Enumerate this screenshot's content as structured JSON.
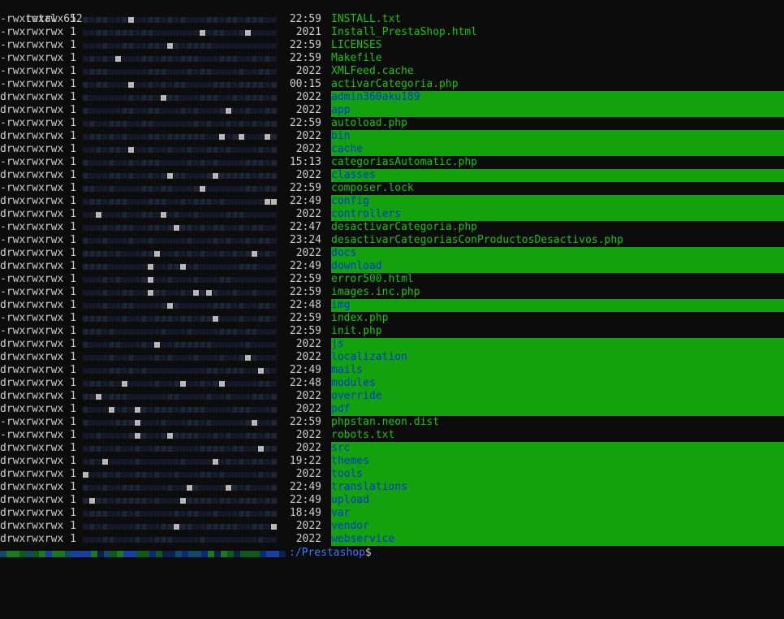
{
  "terminal": {
    "header": "total 652",
    "entries": [
      {
        "perm": "-rwxrwxrwx 1",
        "time": "22:59",
        "name": "INSTALL.txt",
        "dir": false
      },
      {
        "perm": "-rwxrwxrwx 1",
        "time": "2021",
        "name": "Install_PrestaShop.html",
        "dir": false
      },
      {
        "perm": "-rwxrwxrwx 1",
        "time": "22:59",
        "name": "LICENSES",
        "dir": false
      },
      {
        "perm": "-rwxrwxrwx 1",
        "time": "22:59",
        "name": "Makefile",
        "dir": false
      },
      {
        "perm": "-rwxrwxrwx 1",
        "time": "2022",
        "name": "XMLFeed.cache",
        "dir": false
      },
      {
        "perm": "-rwxrwxrwx 1",
        "time": "00:15",
        "name": "activarCategoria.php",
        "dir": false
      },
      {
        "perm": "drwxrwxrwx 1",
        "time": "2022",
        "name": "admin360aku189",
        "dir": true
      },
      {
        "perm": "drwxrwxrwx 1",
        "time": "2022",
        "name": "app",
        "dir": true
      },
      {
        "perm": "-rwxrwxrwx 1",
        "time": "22:59",
        "name": "autoload.php",
        "dir": false
      },
      {
        "perm": "drwxrwxrwx 1",
        "time": "2022",
        "name": "bin",
        "dir": true
      },
      {
        "perm": "drwxrwxrwx 1",
        "time": "2022",
        "name": "cache",
        "dir": true
      },
      {
        "perm": "-rwxrwxrwx 1",
        "time": "15:13",
        "name": "categoriasAutomatic.php",
        "dir": false
      },
      {
        "perm": "drwxrwxrwx 1",
        "time": "2022",
        "name": "classes",
        "dir": true
      },
      {
        "perm": "-rwxrwxrwx 1",
        "time": "22:59",
        "name": "composer.lock",
        "dir": false
      },
      {
        "perm": "drwxrwxrwx 1",
        "time": "22:49",
        "name": "config",
        "dir": true
      },
      {
        "perm": "drwxrwxrwx 1",
        "time": "2022",
        "name": "controllers",
        "dir": true
      },
      {
        "perm": "-rwxrwxrwx 1",
        "time": "22:47",
        "name": "desactivarCategoria.php",
        "dir": false
      },
      {
        "perm": "-rwxrwxrwx 1",
        "time": "23:24",
        "name": "desactivarCategoriasConProductosDesactivos.php",
        "dir": false
      },
      {
        "perm": "drwxrwxrwx 1",
        "time": "2022",
        "name": "docs",
        "dir": true
      },
      {
        "perm": "drwxrwxrwx 1",
        "time": "22:49",
        "name": "download",
        "dir": true
      },
      {
        "perm": "-rwxrwxrwx 1",
        "time": "22:59",
        "name": "error500.html",
        "dir": false
      },
      {
        "perm": "-rwxrwxrwx 1",
        "time": "22:59",
        "name": "images.inc.php",
        "dir": false
      },
      {
        "perm": "drwxrwxrwx 1",
        "time": "22:48",
        "name": "img",
        "dir": true
      },
      {
        "perm": "-rwxrwxrwx 1",
        "time": "22:59",
        "name": "index.php",
        "dir": false
      },
      {
        "perm": "-rwxrwxrwx 1",
        "time": "22:59",
        "name": "init.php",
        "dir": false
      },
      {
        "perm": "drwxrwxrwx 1",
        "time": "2022",
        "name": "js",
        "dir": true
      },
      {
        "perm": "drwxrwxrwx 1",
        "time": "2022",
        "name": "localization",
        "dir": true
      },
      {
        "perm": "drwxrwxrwx 1",
        "time": "22:49",
        "name": "mails",
        "dir": true
      },
      {
        "perm": "drwxrwxrwx 1",
        "time": "22:48",
        "name": "modules",
        "dir": true
      },
      {
        "perm": "drwxrwxrwx 1",
        "time": "2022",
        "name": "override",
        "dir": true
      },
      {
        "perm": "drwxrwxrwx 1",
        "time": "2022",
        "name": "pdf",
        "dir": true
      },
      {
        "perm": "-rwxrwxrwx 1",
        "time": "22:59",
        "name": "phpstan.neon.dist",
        "dir": false
      },
      {
        "perm": "-rwxrwxrwx 1",
        "time": "2022",
        "name": "robots.txt",
        "dir": false
      },
      {
        "perm": "drwxrwxrwx 1",
        "time": "2022",
        "name": "src",
        "dir": true
      },
      {
        "perm": "drwxrwxrwx 1",
        "time": "19:22",
        "name": "themes",
        "dir": true
      },
      {
        "perm": "drwxrwxrwx 1",
        "time": "2022",
        "name": "tools",
        "dir": true
      },
      {
        "perm": "drwxrwxrwx 1",
        "time": "22:49",
        "name": "translations",
        "dir": true
      },
      {
        "perm": "drwxrwxrwx 1",
        "time": "22:49",
        "name": "upload",
        "dir": true
      },
      {
        "perm": "drwxrwxrwx 1",
        "time": "18:49",
        "name": "var",
        "dir": true
      },
      {
        "perm": "drwxrwxrwx 1",
        "time": "2022",
        "name": "vendor",
        "dir": true
      },
      {
        "perm": "drwxrwxrwx 1",
        "time": "2022",
        "name": "webservice",
        "dir": true
      }
    ],
    "prompt": {
      "path": ":/Prestashop",
      "symbol": "$"
    }
  },
  "colors": {
    "background": "#0c0c0c",
    "text": "#cccccc",
    "file_name": "#16c60c",
    "dir_highlight": "#13a10e",
    "dir_name": "#0037da",
    "prompt_path": "#3b78ff",
    "redaction_dark": "#141a2a",
    "redaction_mid": "#1c2438",
    "redaction_light": "#b8b8b8"
  }
}
